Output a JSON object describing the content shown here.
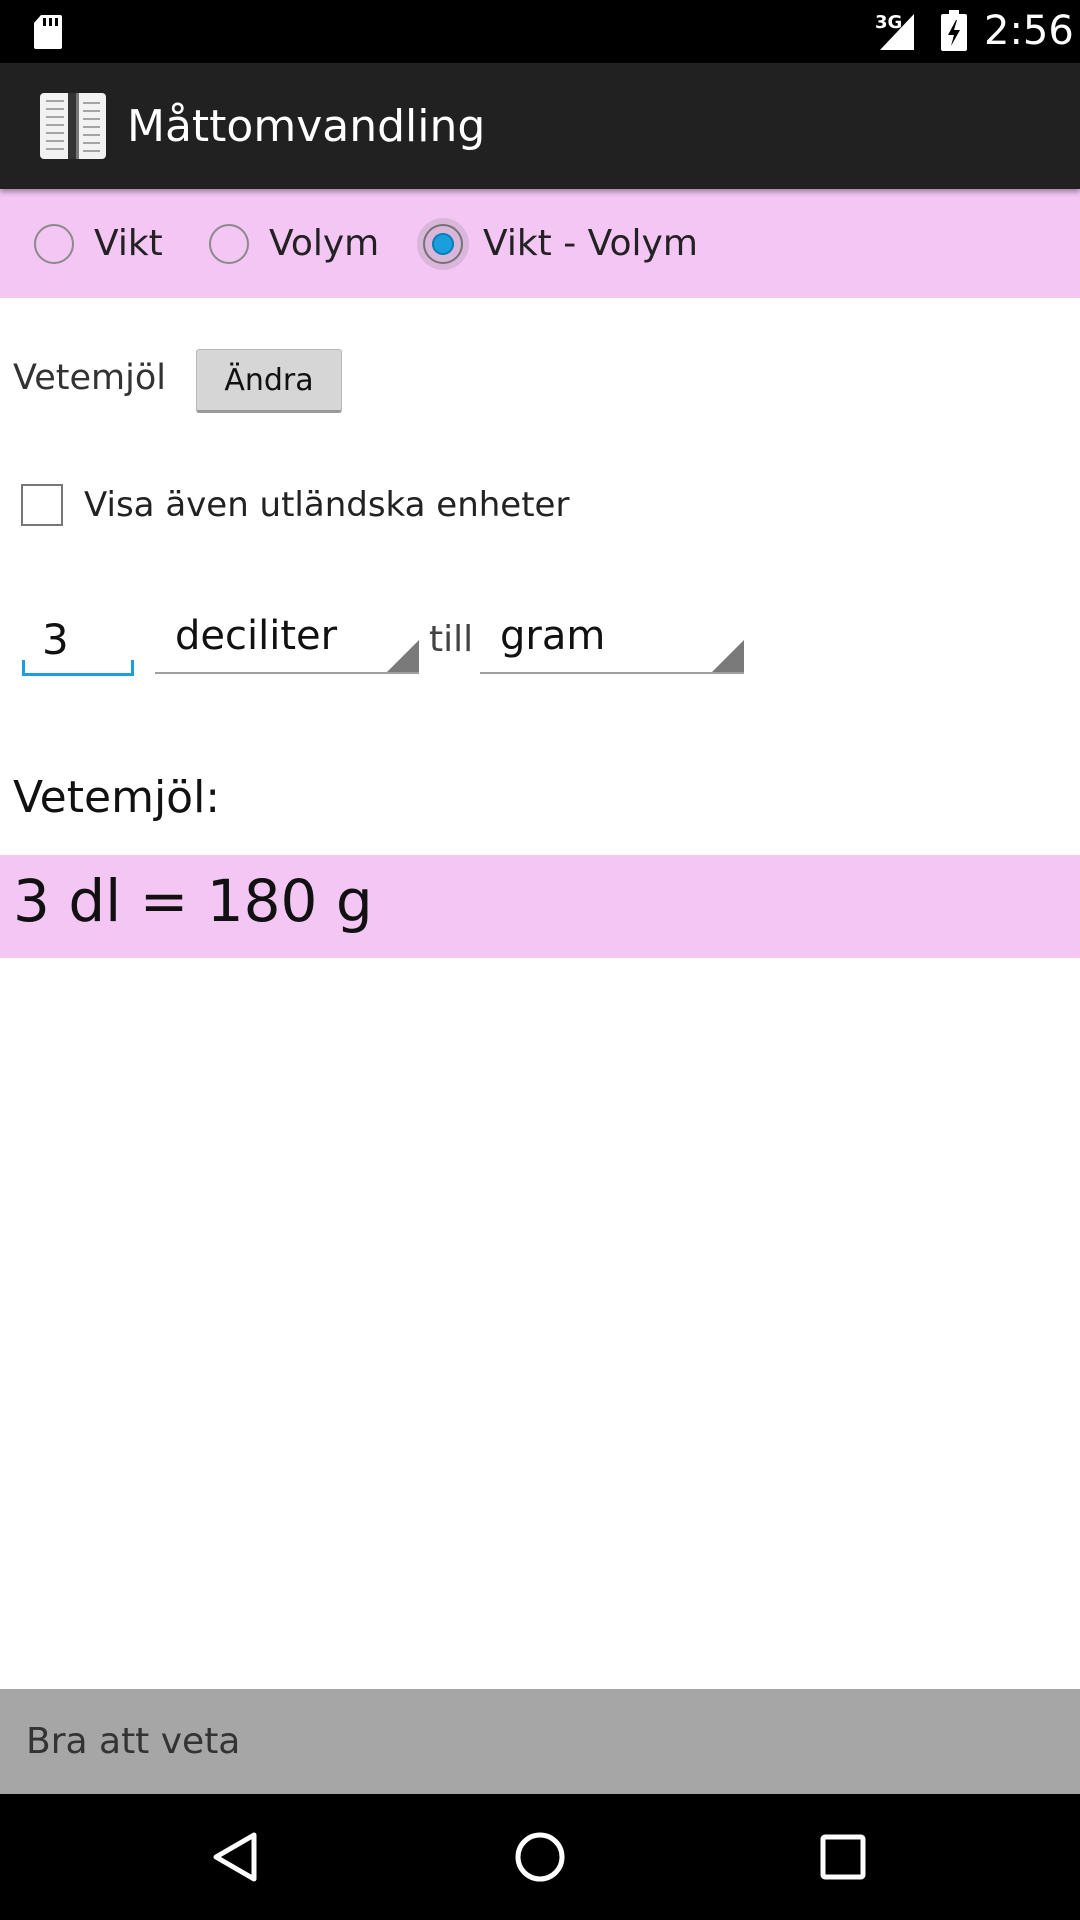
{
  "status_bar": {
    "network": "3G",
    "time": "2:56"
  },
  "action_bar": {
    "title": "Måttomvandling"
  },
  "mode_options": [
    {
      "label": "Vikt",
      "checked": false
    },
    {
      "label": "Volym",
      "checked": false
    },
    {
      "label": "Vikt - Volym",
      "checked": true
    }
  ],
  "ingredient": {
    "name": "Vetemjöl",
    "change_label": "Ändra"
  },
  "foreign_units": {
    "label": "Visa även utländska enheter",
    "checked": false
  },
  "conversion": {
    "amount": "3",
    "from_unit": "deciliter",
    "connector": "till",
    "to_unit": "gram"
  },
  "result": {
    "heading": "Vetemjöl:",
    "text": "3 dl = 180 g"
  },
  "footer": {
    "good_to_know": "Bra att veta"
  },
  "colors": {
    "accent_pink": "#f4c6f4",
    "accent_blue": "#1a9fdc",
    "action_bar": "#212121"
  },
  "icons": {
    "sd_card": "sd-card-icon",
    "signal": "signal-icon",
    "battery": "battery-charging-icon",
    "app": "app-icon",
    "back": "back-icon",
    "home": "home-icon",
    "recents": "recents-icon"
  }
}
